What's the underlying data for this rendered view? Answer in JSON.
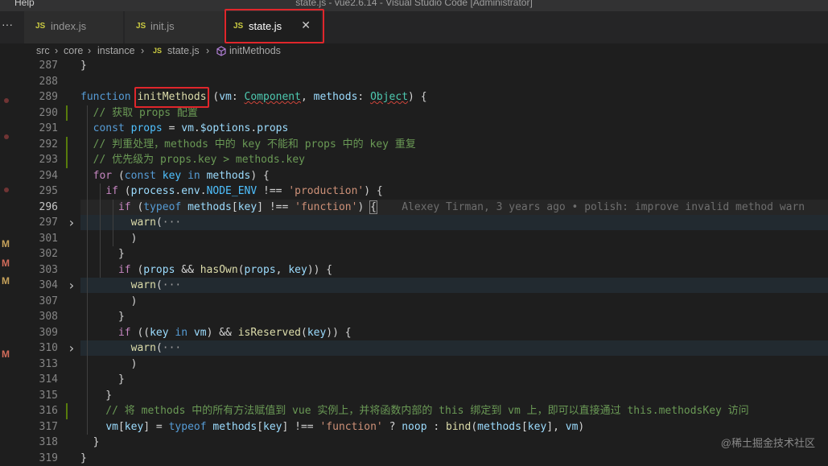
{
  "titlebar": {
    "menu": "Help",
    "window_title": "state.js - vue2.6.14 - Visual Studio Code [Administrator]"
  },
  "tabs": {
    "more": "···",
    "items": [
      {
        "icon": "JS",
        "label": "index.js"
      },
      {
        "icon": "JS",
        "label": "init.js"
      },
      {
        "icon": "JS",
        "label": "state.js",
        "close": "✕"
      }
    ]
  },
  "breadcrumb": {
    "segments": [
      "src",
      "core",
      "instance",
      "state.js",
      "initMethods"
    ],
    "separator": "›",
    "file_icon": "JS"
  },
  "gutter_marks": [
    "M",
    "M",
    "M",
    "M"
  ],
  "blame": "Alexey Tirman, 3 years ago • polish: improve invalid method warn",
  "watermark": "@稀土掘金技术社区",
  "line_numbers": [
    "287",
    "288",
    "289",
    "290",
    "291",
    "292",
    "293",
    "294",
    "295",
    "296",
    "297",
    "301",
    "302",
    "303",
    "304",
    "307",
    "308",
    "309",
    "310",
    "313",
    "314",
    "315",
    "316",
    "317",
    "318",
    "319"
  ],
  "lines": [
    [
      [
        "}",
        "p"
      ]
    ],
    [],
    [
      [
        "function ",
        "k"
      ],
      [
        "initMethods",
        "f"
      ],
      [
        " (",
        "p"
      ],
      [
        "vm",
        "v"
      ],
      [
        ": ",
        "p"
      ],
      [
        "Component",
        "t"
      ],
      [
        ", ",
        "p"
      ],
      [
        "methods",
        "v"
      ],
      [
        ": ",
        "p"
      ],
      [
        "Object",
        "t"
      ],
      [
        ") {",
        "p"
      ]
    ],
    [
      [
        "  // 获取 props 配置",
        "c"
      ]
    ],
    [
      [
        "  ",
        "p"
      ],
      [
        "const ",
        "k"
      ],
      [
        "props",
        "cv"
      ],
      [
        " = ",
        "p"
      ],
      [
        "vm",
        "v"
      ],
      [
        ".",
        "p"
      ],
      [
        "$options",
        "v"
      ],
      [
        ".",
        "p"
      ],
      [
        "props",
        "v"
      ]
    ],
    [
      [
        "  // 判重处理，methods 中的 key 不能和 props 中的 key 重复",
        "c"
      ]
    ],
    [
      [
        "  // 优先级为 props.key > methods.key",
        "c"
      ]
    ],
    [
      [
        "  ",
        "p"
      ],
      [
        "for ",
        "kc"
      ],
      [
        "(",
        "p"
      ],
      [
        "const ",
        "k"
      ],
      [
        "key ",
        "cv"
      ],
      [
        "in ",
        "k"
      ],
      [
        "methods",
        "v"
      ],
      [
        ") {",
        "p"
      ]
    ],
    [
      [
        "    ",
        "p"
      ],
      [
        "if ",
        "kc"
      ],
      [
        "(",
        "p"
      ],
      [
        "process",
        "v"
      ],
      [
        ".",
        "p"
      ],
      [
        "env",
        "v"
      ],
      [
        ".",
        "p"
      ],
      [
        "NODE_ENV",
        "cv"
      ],
      [
        " !== ",
        "p"
      ],
      [
        "'production'",
        "s"
      ],
      [
        ") {",
        "p"
      ]
    ],
    [
      [
        "      ",
        "p"
      ],
      [
        "if ",
        "kc"
      ],
      [
        "(",
        "p"
      ],
      [
        "typeof ",
        "k"
      ],
      [
        "methods",
        "v"
      ],
      [
        "[",
        "p"
      ],
      [
        "key",
        "v"
      ],
      [
        "] !== ",
        "p"
      ],
      [
        "'function'",
        "s"
      ],
      [
        ") ",
        "p"
      ],
      [
        "{",
        "p"
      ]
    ],
    [
      [
        "        ",
        "p"
      ],
      [
        "warn",
        "f"
      ],
      [
        "(",
        "p"
      ],
      [
        "···",
        "bl"
      ]
    ],
    [
      [
        "        )",
        "p"
      ]
    ],
    [
      [
        "      }",
        "p"
      ]
    ],
    [
      [
        "      ",
        "p"
      ],
      [
        "if ",
        "kc"
      ],
      [
        "(",
        "p"
      ],
      [
        "props",
        "v"
      ],
      [
        " && ",
        "p"
      ],
      [
        "hasOwn",
        "f"
      ],
      [
        "(",
        "p"
      ],
      [
        "props",
        "v"
      ],
      [
        ", ",
        "p"
      ],
      [
        "key",
        "v"
      ],
      [
        ")) {",
        "p"
      ]
    ],
    [
      [
        "        ",
        "p"
      ],
      [
        "warn",
        "f"
      ],
      [
        "(",
        "p"
      ],
      [
        "···",
        "bl"
      ]
    ],
    [
      [
        "        )",
        "p"
      ]
    ],
    [
      [
        "      }",
        "p"
      ]
    ],
    [
      [
        "      ",
        "p"
      ],
      [
        "if ",
        "kc"
      ],
      [
        "((",
        "p"
      ],
      [
        "key ",
        "v"
      ],
      [
        "in ",
        "k"
      ],
      [
        "vm",
        "v"
      ],
      [
        ") && ",
        "p"
      ],
      [
        "isReserved",
        "f"
      ],
      [
        "(",
        "p"
      ],
      [
        "key",
        "v"
      ],
      [
        ")) {",
        "p"
      ]
    ],
    [
      [
        "        ",
        "p"
      ],
      [
        "warn",
        "f"
      ],
      [
        "(",
        "p"
      ],
      [
        "···",
        "bl"
      ]
    ],
    [
      [
        "        )",
        "p"
      ]
    ],
    [
      [
        "      }",
        "p"
      ]
    ],
    [
      [
        "    }",
        "p"
      ]
    ],
    [
      [
        "    // 将 methods 中的所有方法赋值到 vue 实例上，并将函数内部的 this 绑定到 vm 上，即可以直接通过 this.methodsKey 访问",
        "c"
      ]
    ],
    [
      [
        "    ",
        "p"
      ],
      [
        "vm",
        "v"
      ],
      [
        "[",
        "p"
      ],
      [
        "key",
        "v"
      ],
      [
        "] = ",
        "p"
      ],
      [
        "typeof ",
        "k"
      ],
      [
        "methods",
        "v"
      ],
      [
        "[",
        "p"
      ],
      [
        "key",
        "v"
      ],
      [
        "] !== ",
        "p"
      ],
      [
        "'function'",
        "s"
      ],
      [
        " ? ",
        "p"
      ],
      [
        "noop",
        "v"
      ],
      [
        " : ",
        "p"
      ],
      [
        "bind",
        "f"
      ],
      [
        "(",
        "p"
      ],
      [
        "methods",
        "v"
      ],
      [
        "[",
        "p"
      ],
      [
        "key",
        "v"
      ],
      [
        "], ",
        "p"
      ],
      [
        "vm",
        "v"
      ],
      [
        ")",
        "p"
      ]
    ],
    [
      [
        "  }",
        "p"
      ]
    ],
    [
      [
        "}",
        "p"
      ]
    ]
  ]
}
